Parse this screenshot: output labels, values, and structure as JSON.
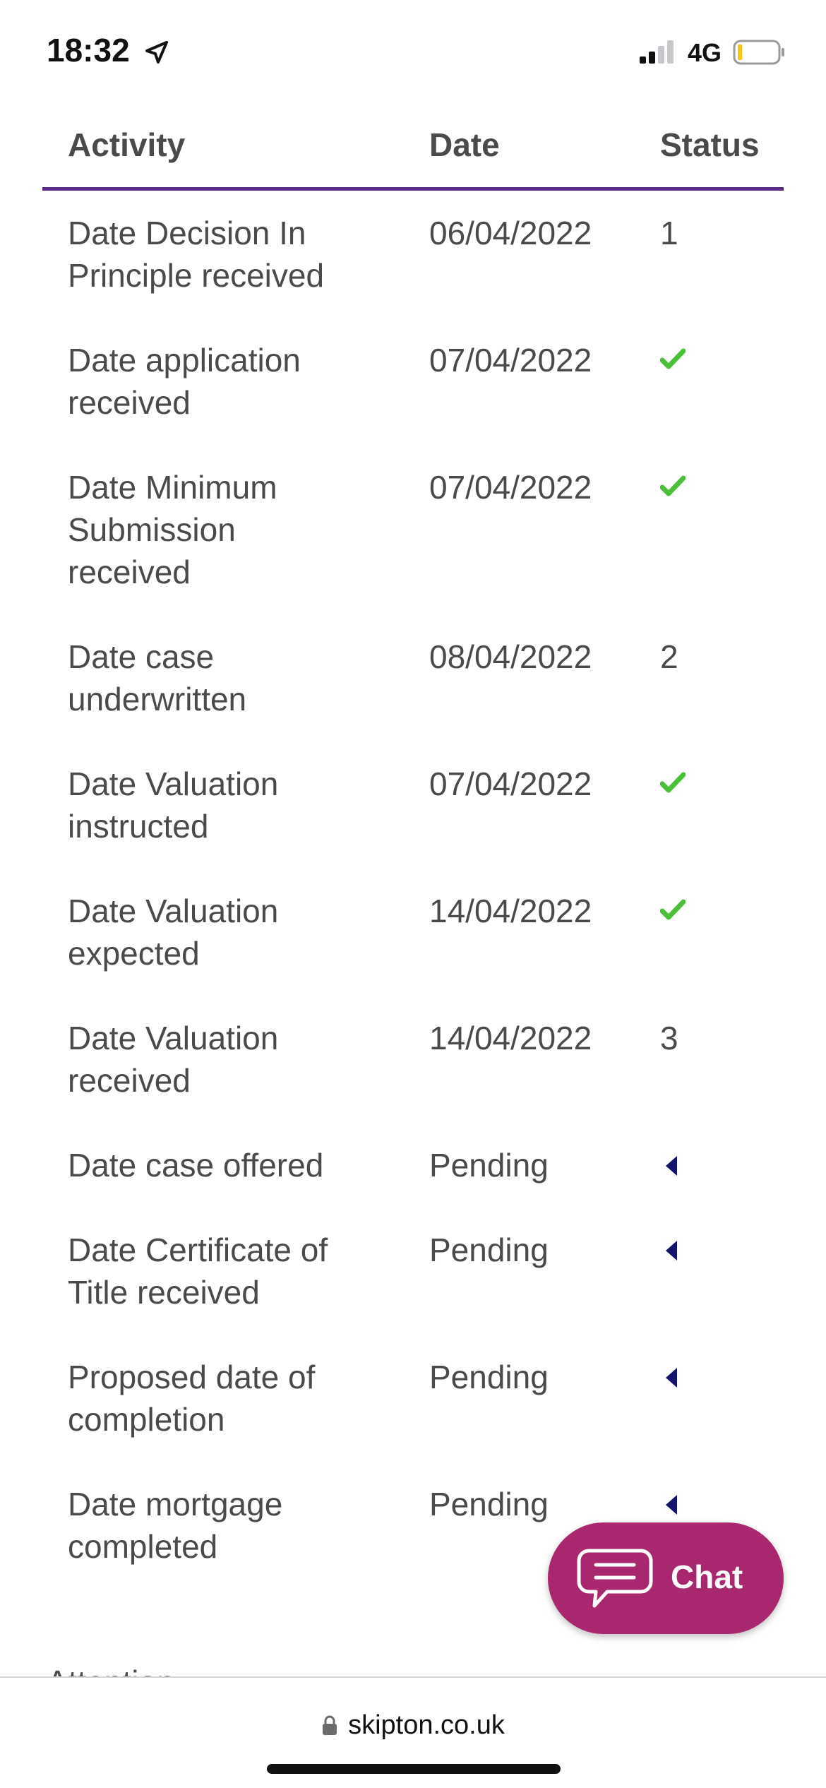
{
  "status_bar": {
    "time": "18:32",
    "network": "4G",
    "icons": [
      "location-arrow-icon",
      "cellular-signal-icon",
      "battery-icon"
    ],
    "battery_color": "#f5c518"
  },
  "table": {
    "headers": {
      "activity": "Activity",
      "date": "Date",
      "status": "Status"
    },
    "accent_color": "#5b2a86",
    "rows": [
      {
        "activity": "Date Decision In Principle received",
        "date": "06/04/2022",
        "status_type": "text",
        "status": "1"
      },
      {
        "activity": "Date application received",
        "date": "07/04/2022",
        "status_type": "check",
        "status": "check-icon"
      },
      {
        "activity": "Date Minimum Submission received",
        "date": "07/04/2022",
        "status_type": "check",
        "status": "check-icon"
      },
      {
        "activity": "Date case underwritten",
        "date": "08/04/2022",
        "status_type": "text",
        "status": "2"
      },
      {
        "activity": "Date Valuation instructed",
        "date": "07/04/2022",
        "status_type": "check",
        "status": "check-icon"
      },
      {
        "activity": "Date Valuation expected",
        "date": "14/04/2022",
        "status_type": "check",
        "status": "check-icon"
      },
      {
        "activity": "Date Valuation received",
        "date": "14/04/2022",
        "status_type": "text",
        "status": "3"
      },
      {
        "activity": "Date case offered",
        "date": "Pending",
        "status_type": "arrow",
        "status": "left-arrow-icon"
      },
      {
        "activity": "Date Certificate of Title received",
        "date": "Pending",
        "status_type": "arrow",
        "status": "left-arrow-icon"
      },
      {
        "activity": "Proposed date of completion",
        "date": "Pending",
        "status_type": "arrow",
        "status": "left-arrow-icon"
      },
      {
        "activity": "Date mortgage completed",
        "date": "Pending",
        "status_type": "arrow",
        "status": "left-arrow-icon"
      }
    ]
  },
  "chat": {
    "label": "Chat",
    "color": "#a8276e",
    "icon": "speech-bubble-icon"
  },
  "partial_heading": "Attention",
  "browser": {
    "url": "skipton.co.uk",
    "icon": "lock-icon"
  }
}
